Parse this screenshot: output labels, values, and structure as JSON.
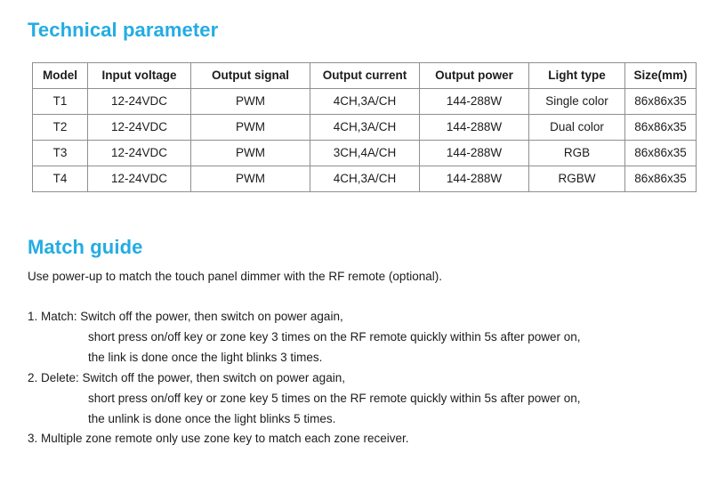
{
  "theme": {
    "heading_color": "#23ACE3",
    "text_color": "#1c1c1c",
    "table_border_color": "#8f8f8f",
    "background": "#ffffff"
  },
  "sections": {
    "technical": {
      "heading": "Technical parameter"
    },
    "match": {
      "heading": "Match guide",
      "intro": "Use power-up to match the touch panel dimmer with the RF remote (optional)."
    }
  },
  "spec_table": {
    "columns": [
      "Model",
      "Input voltage",
      "Output signal",
      "Output current",
      "Output power",
      "Light type",
      "Size(mm)"
    ],
    "rows": [
      [
        "T1",
        "12-24VDC",
        "PWM",
        "4CH,3A/CH",
        "144-288W",
        "Single color",
        "86x86x35"
      ],
      [
        "T2",
        "12-24VDC",
        "PWM",
        "4CH,3A/CH",
        "144-288W",
        "Dual color",
        "86x86x35"
      ],
      [
        "T3",
        "12-24VDC",
        "PWM",
        "3CH,4A/CH",
        "144-288W",
        "RGB",
        "86x86x35"
      ],
      [
        "T4",
        "12-24VDC",
        "PWM",
        "4CH,3A/CH",
        "144-288W",
        "RGBW",
        "86x86x35"
      ]
    ]
  },
  "steps": [
    {
      "lines": [
        "1. Match: Switch off the power, then switch on power again,",
        "short press on/off key or zone key 3 times on the RF remote quickly within 5s after power on,",
        "the link is done once the light blinks 3 times."
      ]
    },
    {
      "lines": [
        "2. Delete: Switch off the power, then switch on power again,",
        "short press on/off key or zone key 5 times on the RF remote quickly within 5s after power on,",
        "the unlink is done once the light blinks 5 times."
      ]
    },
    {
      "lines": [
        "3. Multiple zone remote only use zone key to match each zone receiver."
      ]
    }
  ]
}
